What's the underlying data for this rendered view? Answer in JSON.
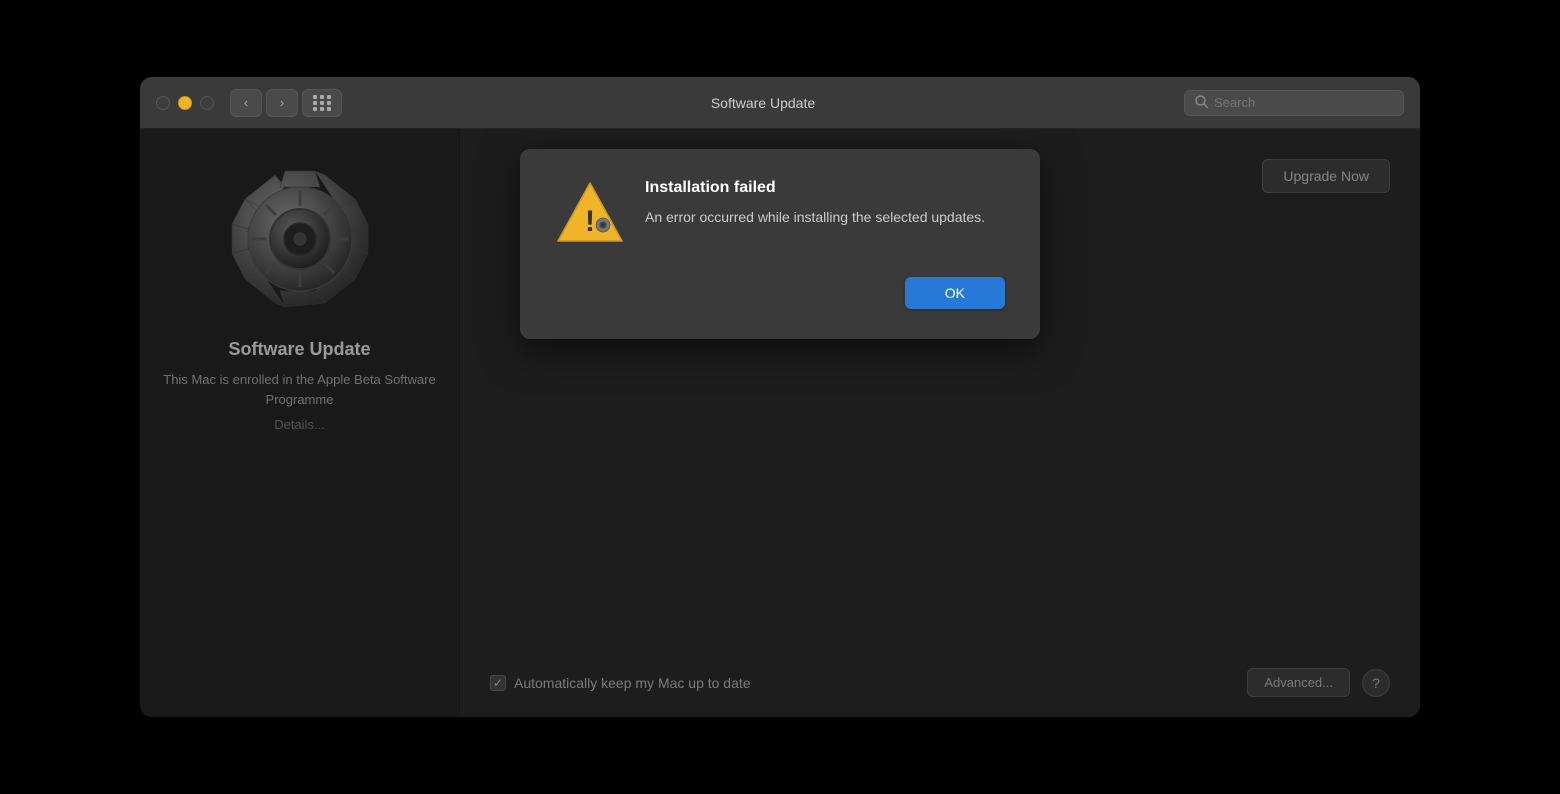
{
  "window": {
    "title": "Software Update"
  },
  "titlebar": {
    "search_placeholder": "Search",
    "back_label": "‹",
    "forward_label": "›"
  },
  "sidebar": {
    "icon_alt": "Software Update gear icon",
    "title": "Software Update",
    "subtitle": "This Mac is enrolled in the Apple Beta Software Programme",
    "details_label": "Details..."
  },
  "right_panel": {
    "upgrade_btn_label": "Upgrade Now",
    "checkbox_label": "Automatically keep my Mac up to date",
    "checkbox_checked": true,
    "advanced_btn_label": "Advanced...",
    "help_btn_label": "?"
  },
  "modal": {
    "title": "Installation failed",
    "message": "An error occurred while installing the selected updates.",
    "ok_label": "OK",
    "icon_alt": "Warning icon with gear"
  }
}
